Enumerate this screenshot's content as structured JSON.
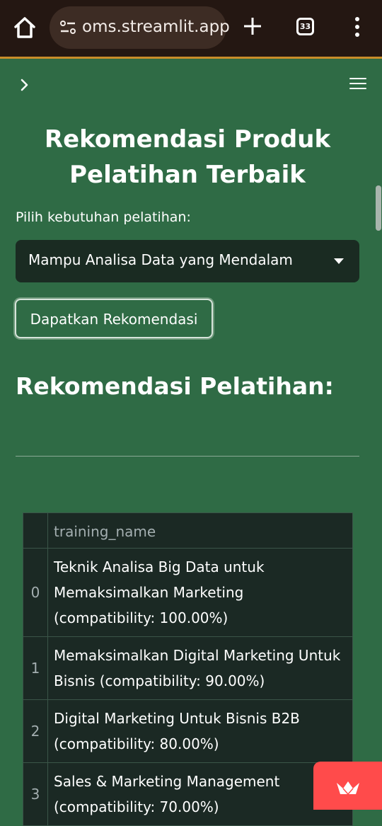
{
  "browser": {
    "url": "oms.streamlit.app",
    "tab_count": "33"
  },
  "app": {
    "title": "Rekomendasi Produk Pelatihan Terbaik",
    "select": {
      "label": "Pilih kebutuhan pelatihan:",
      "value": "Mampu Analisa Data yang Mendalam"
    },
    "button_label": "Dapatkan Rekomendasi",
    "results_heading": "Rekomendasi Pelatihan:",
    "table": {
      "column_header": "training_name",
      "rows": [
        {
          "index": "0",
          "training_name": "Teknik Analisa Big Data untuk Memaksimalkan Marketing (compatibility: 100.00%)"
        },
        {
          "index": "1",
          "training_name": "Memaksimalkan Digital Marketing Untuk Bisnis (compatibility: 90.00%)"
        },
        {
          "index": "2",
          "training_name": "Digital Marketing Untuk Bisnis B2B (compatibility: 80.00%)"
        },
        {
          "index": "3",
          "training_name": "Sales & Marketing Management (compatibility: 70.00%)"
        }
      ]
    }
  },
  "icons": {
    "home": "home-icon",
    "site_info": "tune-icon",
    "new_tab": "plus-icon",
    "tabs": "tab-switcher-icon",
    "overflow": "more-vert-icon",
    "sidebar": "chevron-right-icon",
    "app_menu": "hamburger-icon",
    "badge": "streamlit-crown-icon"
  },
  "colors": {
    "background": "#2f6b45",
    "chrome": "#241712",
    "table_bg": "#1b2924",
    "badge": "#ff4b4b"
  }
}
